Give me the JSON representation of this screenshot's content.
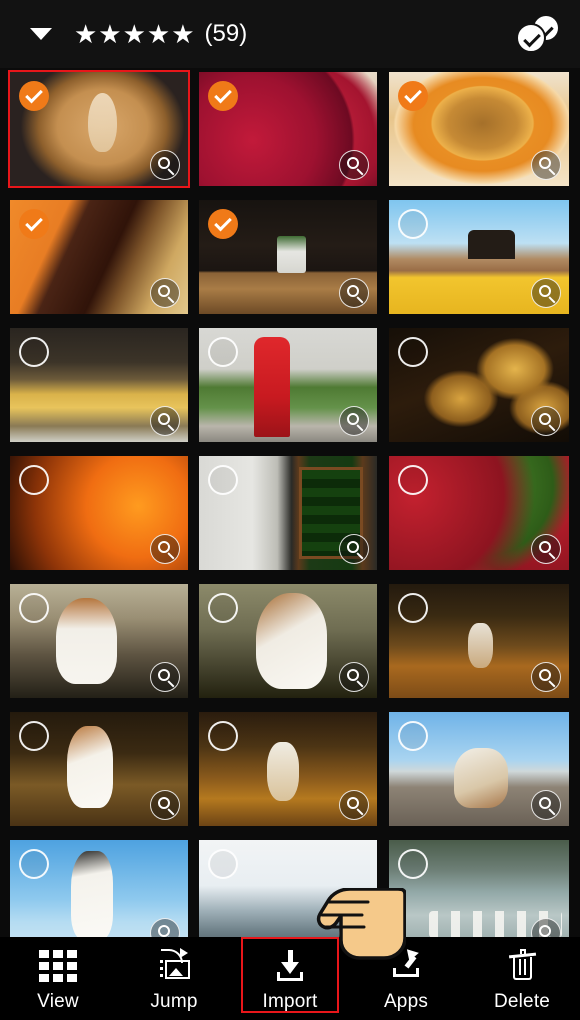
{
  "header": {
    "caret_icon": "chevron-down-icon",
    "stars": "★★★★★",
    "star_count": 5,
    "rating_count_label": "(59)",
    "select_all_icon": "select-all-check-icon"
  },
  "colors": {
    "background": "#0b0b0b",
    "header_background": "#121212",
    "selection_orange": "#f07a18",
    "focus_red": "#e8161a",
    "text": "#ffffff"
  },
  "grid": {
    "columns": 3,
    "selected_count": 5,
    "tiles": [
      {
        "id": 1,
        "subject": "latte-art-coffee-cup",
        "selected": true,
        "focused": true,
        "art": "ph-latte"
      },
      {
        "id": 2,
        "subject": "raspberry-dessert",
        "selected": true,
        "focused": false,
        "art": "ph-berry"
      },
      {
        "id": 3,
        "subject": "orange-slice-pastry",
        "selected": true,
        "focused": false,
        "art": "ph-orange"
      },
      {
        "id": 4,
        "subject": "chocolate-orange-dessert",
        "selected": true,
        "focused": false,
        "art": "ph-dessert"
      },
      {
        "id": 5,
        "subject": "cafe-table-with-plant",
        "selected": true,
        "focused": false,
        "art": "ph-cafe"
      },
      {
        "id": 6,
        "subject": "yellow-umbrella-rooftop",
        "selected": false,
        "focused": false,
        "art": "ph-umbrella"
      },
      {
        "id": 7,
        "subject": "shop-window-display",
        "selected": false,
        "focused": false,
        "art": "ph-window"
      },
      {
        "id": 8,
        "subject": "red-postbox-street",
        "selected": false,
        "focused": false,
        "art": "ph-postbox"
      },
      {
        "id": 9,
        "subject": "egg-tarts-tray",
        "selected": false,
        "focused": false,
        "art": "ph-tarts"
      },
      {
        "id": 10,
        "subject": "orange-candy-jar",
        "selected": false,
        "focused": false,
        "art": "ph-candy"
      },
      {
        "id": 11,
        "subject": "sweet-shop-free-flow-tasting-sign",
        "selected": false,
        "focused": false,
        "art": "ph-shopfront"
      },
      {
        "id": 12,
        "subject": "remarkable-sweet-shop-jars",
        "selected": false,
        "focused": false,
        "art": "ph-jars"
      },
      {
        "id": 13,
        "subject": "jack-russell-terrier-sitting",
        "selected": false,
        "focused": false,
        "art": "ph-dog1"
      },
      {
        "id": 14,
        "subject": "jack-russell-terrier-profile",
        "selected": false,
        "focused": false,
        "art": "ph-dog2"
      },
      {
        "id": 15,
        "subject": "dog-running-in-woods",
        "selected": false,
        "focused": false,
        "art": "ph-dogrun1"
      },
      {
        "id": 16,
        "subject": "dog-running-autumn-path",
        "selected": false,
        "focused": false,
        "art": "ph-dogrun3"
      },
      {
        "id": 17,
        "subject": "dog-running-towards-camera",
        "selected": false,
        "focused": false,
        "art": "ph-dogrun2"
      },
      {
        "id": 18,
        "subject": "dog-on-pebble-beach",
        "selected": false,
        "focused": false,
        "art": "ph-dogbeach"
      },
      {
        "id": 19,
        "subject": "dog-jumping-blue-sky",
        "selected": false,
        "focused": false,
        "art": "ph-dogjump"
      },
      {
        "id": 20,
        "subject": "lake-and-mountains",
        "selected": false,
        "focused": false,
        "art": "ph-lake"
      },
      {
        "id": 21,
        "subject": "seagulls-on-shoreline",
        "selected": false,
        "focused": false,
        "art": "ph-gulls"
      }
    ],
    "tile_icons": {
      "selected_badge": "check-circle-icon",
      "unselected_badge": "empty-circle-icon",
      "zoom": "magnifier-icon"
    }
  },
  "toolbar": {
    "items": [
      {
        "label": "View",
        "icon": "grid-icon",
        "highlighted": false
      },
      {
        "label": "Jump",
        "icon": "jump-to-image-icon",
        "highlighted": false
      },
      {
        "label": "Import",
        "icon": "download-icon",
        "highlighted": true
      },
      {
        "label": "Apps",
        "icon": "share-icon",
        "highlighted": false
      },
      {
        "label": "Delete",
        "icon": "trash-icon",
        "highlighted": false
      }
    ]
  },
  "cursor": {
    "icon": "pointing-hand-cursor",
    "target": "Import"
  }
}
